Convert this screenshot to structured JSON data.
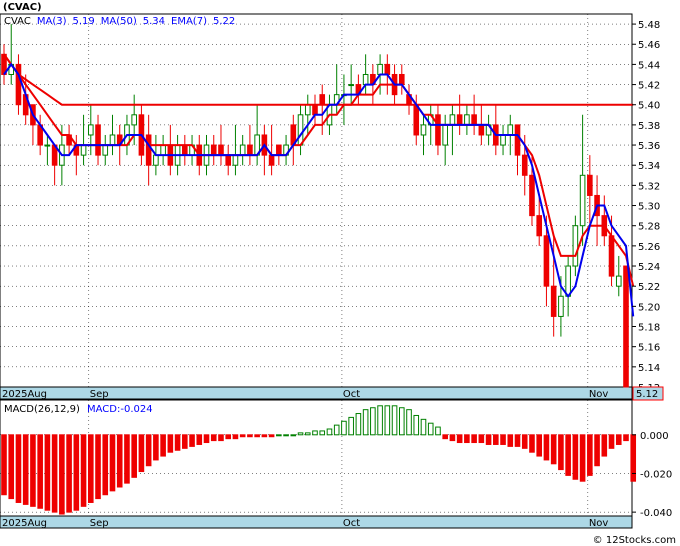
{
  "header": {
    "ticker": "(CVAC)",
    "legend": [
      {
        "label": "CVAC",
        "color": "#000000"
      },
      {
        "label": "MA(3)",
        "color": "#0000ff"
      },
      {
        "label": "5.19",
        "color": "#0000ff"
      },
      {
        "label": "MA(50)",
        "color": "#0000ff"
      },
      {
        "label": "5.34",
        "color": "#0000ff"
      },
      {
        "label": "EMA(7)",
        "color": "#0000ff"
      },
      {
        "label": "5.22",
        "color": "#0000ff"
      }
    ]
  },
  "macd_header": {
    "name": "MACD(26,12,9)",
    "value_label": "MACD:-0.024"
  },
  "footer": {
    "watermark": "© 12Stocks.com"
  },
  "colors": {
    "up": "#008000",
    "down": "#ee0000",
    "ma3": "#0000ee",
    "ema": "#ee0000",
    "axis_bg": "#add8e6",
    "last_price_bg": "#add8e6",
    "grid": "#000000"
  },
  "chart_data": [
    {
      "type": "candlestick",
      "title": "(CVAC)",
      "ylim": [
        5.12,
        5.49
      ],
      "yticks": [
        5.12,
        5.14,
        5.16,
        5.18,
        5.2,
        5.22,
        5.24,
        5.26,
        5.28,
        5.3,
        5.32,
        5.34,
        5.36,
        5.38,
        5.4,
        5.42,
        5.44,
        5.46,
        5.48
      ],
      "last_price": "5.12",
      "x_labels": [
        "2025Aug",
        "Sep",
        "Oct",
        "Nov"
      ],
      "x_label_index": [
        0,
        12,
        47,
        81
      ],
      "grid": true,
      "ohlc": [
        [
          5.45,
          5.46,
          5.42,
          5.43
        ],
        [
          5.43,
          5.48,
          5.42,
          5.44
        ],
        [
          5.44,
          5.45,
          5.39,
          5.4
        ],
        [
          5.41,
          5.43,
          5.38,
          5.39
        ],
        [
          5.4,
          5.4,
          5.36,
          5.38
        ],
        [
          5.38,
          5.39,
          5.35,
          5.36
        ],
        [
          5.36,
          5.37,
          5.34,
          5.36
        ],
        [
          5.36,
          5.36,
          5.32,
          5.34
        ],
        [
          5.34,
          5.38,
          5.32,
          5.36
        ],
        [
          5.37,
          5.38,
          5.35,
          5.36
        ],
        [
          5.36,
          5.37,
          5.33,
          5.35
        ],
        [
          5.35,
          5.39,
          5.34,
          5.36
        ],
        [
          5.37,
          5.4,
          5.35,
          5.38
        ],
        [
          5.38,
          5.39,
          5.34,
          5.35
        ],
        [
          5.35,
          5.37,
          5.34,
          5.36
        ],
        [
          5.36,
          5.39,
          5.35,
          5.37
        ],
        [
          5.37,
          5.38,
          5.34,
          5.36
        ],
        [
          5.36,
          5.39,
          5.35,
          5.38
        ],
        [
          5.38,
          5.41,
          5.36,
          5.39
        ],
        [
          5.39,
          5.4,
          5.34,
          5.35
        ],
        [
          5.37,
          5.39,
          5.32,
          5.34
        ],
        [
          5.34,
          5.37,
          5.33,
          5.35
        ],
        [
          5.35,
          5.37,
          5.34,
          5.36
        ],
        [
          5.36,
          5.38,
          5.33,
          5.34
        ],
        [
          5.34,
          5.37,
          5.33,
          5.36
        ],
        [
          5.36,
          5.37,
          5.34,
          5.35
        ],
        [
          5.35,
          5.37,
          5.34,
          5.36
        ],
        [
          5.36,
          5.37,
          5.33,
          5.34
        ],
        [
          5.34,
          5.37,
          5.33,
          5.36
        ],
        [
          5.36,
          5.37,
          5.34,
          5.35
        ],
        [
          5.36,
          5.38,
          5.34,
          5.35
        ],
        [
          5.35,
          5.36,
          5.33,
          5.34
        ],
        [
          5.34,
          5.38,
          5.33,
          5.35
        ],
        [
          5.35,
          5.37,
          5.34,
          5.36
        ],
        [
          5.36,
          5.38,
          5.34,
          5.35
        ],
        [
          5.35,
          5.4,
          5.34,
          5.37
        ],
        [
          5.37,
          5.38,
          5.33,
          5.35
        ],
        [
          5.35,
          5.38,
          5.33,
          5.34
        ],
        [
          5.36,
          5.36,
          5.34,
          5.35
        ],
        [
          5.35,
          5.37,
          5.34,
          5.36
        ],
        [
          5.38,
          5.39,
          5.34,
          5.36
        ],
        [
          5.36,
          5.4,
          5.35,
          5.39
        ],
        [
          5.39,
          5.41,
          5.37,
          5.4
        ],
        [
          5.4,
          5.41,
          5.38,
          5.39
        ],
        [
          5.41,
          5.42,
          5.37,
          5.4
        ],
        [
          5.38,
          5.41,
          5.37,
          5.4
        ],
        [
          5.4,
          5.44,
          5.39,
          5.41
        ],
        [
          5.41,
          5.43,
          5.38,
          5.41
        ],
        [
          5.42,
          5.44,
          5.4,
          5.42
        ],
        [
          5.42,
          5.43,
          5.4,
          5.41
        ],
        [
          5.42,
          5.45,
          5.41,
          5.43
        ],
        [
          5.43,
          5.44,
          5.4,
          5.42
        ],
        [
          5.43,
          5.45,
          5.41,
          5.44
        ],
        [
          5.44,
          5.45,
          5.41,
          5.43
        ],
        [
          5.43,
          5.44,
          5.4,
          5.41
        ],
        [
          5.43,
          5.44,
          5.41,
          5.42
        ],
        [
          5.41,
          5.42,
          5.39,
          5.4
        ],
        [
          5.4,
          5.41,
          5.36,
          5.37
        ],
        [
          5.37,
          5.39,
          5.35,
          5.38
        ],
        [
          5.38,
          5.4,
          5.36,
          5.39
        ],
        [
          5.39,
          5.4,
          5.35,
          5.36
        ],
        [
          5.36,
          5.39,
          5.34,
          5.38
        ],
        [
          5.38,
          5.4,
          5.35,
          5.39
        ],
        [
          5.39,
          5.41,
          5.37,
          5.38
        ],
        [
          5.38,
          5.4,
          5.37,
          5.39
        ],
        [
          5.39,
          5.41,
          5.37,
          5.38
        ],
        [
          5.38,
          5.4,
          5.36,
          5.37
        ],
        [
          5.37,
          5.39,
          5.36,
          5.38
        ],
        [
          5.38,
          5.4,
          5.35,
          5.36
        ],
        [
          5.36,
          5.38,
          5.35,
          5.37
        ],
        [
          5.37,
          5.39,
          5.35,
          5.38
        ],
        [
          5.38,
          5.38,
          5.33,
          5.35
        ],
        [
          5.35,
          5.37,
          5.31,
          5.33
        ],
        [
          5.33,
          5.35,
          5.28,
          5.29
        ],
        [
          5.29,
          5.31,
          5.26,
          5.27
        ],
        [
          5.27,
          5.29,
          5.2,
          5.22
        ],
        [
          5.22,
          5.27,
          5.17,
          5.19
        ],
        [
          5.19,
          5.23,
          5.17,
          5.21
        ],
        [
          5.21,
          5.25,
          5.19,
          5.24
        ],
        [
          5.24,
          5.29,
          5.23,
          5.28
        ],
        [
          5.28,
          5.39,
          5.26,
          5.33
        ],
        [
          5.33,
          5.35,
          5.28,
          5.31
        ],
        [
          5.31,
          5.33,
          5.26,
          5.29
        ],
        [
          5.29,
          5.31,
          5.26,
          5.27
        ],
        [
          5.27,
          5.29,
          5.22,
          5.23
        ],
        [
          5.22,
          5.25,
          5.21,
          5.23
        ],
        [
          5.24,
          5.24,
          5.12,
          5.12
        ]
      ],
      "ma3": [
        5.43,
        5.44,
        5.43,
        5.41,
        5.39,
        5.38,
        5.37,
        5.36,
        5.35,
        5.35,
        5.36,
        5.36,
        5.36,
        5.36,
        5.36,
        5.36,
        5.36,
        5.37,
        5.37,
        5.37,
        5.36,
        5.35,
        5.35,
        5.35,
        5.35,
        5.35,
        5.35,
        5.35,
        5.35,
        5.35,
        5.35,
        5.35,
        5.35,
        5.35,
        5.35,
        5.35,
        5.36,
        5.35,
        5.35,
        5.35,
        5.36,
        5.37,
        5.38,
        5.39,
        5.39,
        5.4,
        5.4,
        5.41,
        5.41,
        5.41,
        5.42,
        5.42,
        5.43,
        5.43,
        5.42,
        5.42,
        5.41,
        5.4,
        5.39,
        5.38,
        5.38,
        5.38,
        5.38,
        5.38,
        5.38,
        5.38,
        5.38,
        5.38,
        5.37,
        5.37,
        5.37,
        5.37,
        5.36,
        5.34,
        5.31,
        5.28,
        5.25,
        5.22,
        5.21,
        5.22,
        5.25,
        5.28,
        5.3,
        5.3,
        5.28,
        5.27,
        5.26,
        5.19
      ],
      "ema7": [
        5.45,
        5.44,
        5.43,
        5.42,
        5.41,
        5.4,
        5.39,
        5.38,
        5.37,
        5.37,
        5.36,
        5.36,
        5.36,
        5.36,
        5.36,
        5.36,
        5.36,
        5.36,
        5.37,
        5.37,
        5.36,
        5.36,
        5.36,
        5.36,
        5.36,
        5.36,
        5.36,
        5.35,
        5.35,
        5.35,
        5.35,
        5.35,
        5.35,
        5.35,
        5.35,
        5.35,
        5.36,
        5.35,
        5.35,
        5.35,
        5.36,
        5.36,
        5.37,
        5.38,
        5.38,
        5.39,
        5.39,
        5.4,
        5.4,
        5.41,
        5.41,
        5.41,
        5.42,
        5.42,
        5.42,
        5.42,
        5.41,
        5.4,
        5.39,
        5.39,
        5.38,
        5.38,
        5.38,
        5.38,
        5.38,
        5.38,
        5.38,
        5.38,
        5.37,
        5.37,
        5.37,
        5.37,
        5.36,
        5.35,
        5.33,
        5.3,
        5.27,
        5.25,
        5.25,
        5.25,
        5.27,
        5.28,
        5.28,
        5.28,
        5.27,
        5.26,
        5.25,
        5.22
      ],
      "ma50": [
        5.45,
        5.44,
        5.43,
        5.425,
        5.42,
        5.415,
        5.41,
        5.405,
        5.4,
        5.4,
        5.4,
        5.4,
        5.4,
        5.4,
        5.4,
        5.4,
        5.4,
        5.4,
        5.4,
        5.4,
        5.4,
        5.4,
        5.4,
        5.4,
        5.4,
        5.4,
        5.4,
        5.4,
        5.4,
        5.4,
        5.4,
        5.4,
        5.4,
        5.4,
        5.4,
        5.4,
        5.4,
        5.4,
        5.4,
        5.4,
        5.4,
        5.4,
        5.4,
        5.4,
        5.4,
        5.4,
        5.4,
        5.4,
        5.4,
        5.4,
        5.4,
        5.4,
        5.4,
        5.4,
        5.4,
        5.4,
        5.4,
        5.4,
        5.4,
        5.4,
        5.4,
        5.4,
        5.4,
        5.4,
        5.4,
        5.4,
        5.4,
        5.4,
        5.4,
        5.4,
        5.4,
        5.4,
        5.4,
        5.4,
        5.4,
        5.4,
        5.4,
        5.4,
        5.4,
        5.4,
        5.4,
        5.4,
        5.4,
        5.4,
        5.4,
        5.4,
        5.4,
        5.4
      ]
    },
    {
      "type": "bar",
      "title": "MACD(26,12,9)",
      "ylim": [
        -0.042,
        0.018
      ],
      "yticks": [
        0.0,
        -0.02,
        -0.04
      ],
      "ytick_labels": [
        "0.000",
        "-0.020",
        "-0.040"
      ],
      "x_labels": [
        "2025Aug",
        "Sep",
        "Oct",
        "Nov"
      ],
      "x_label_index": [
        0,
        12,
        47,
        81
      ],
      "values": [
        -0.031,
        -0.033,
        -0.035,
        -0.036,
        -0.037,
        -0.038,
        -0.039,
        -0.04,
        -0.041,
        -0.04,
        -0.039,
        -0.037,
        -0.035,
        -0.033,
        -0.031,
        -0.029,
        -0.027,
        -0.025,
        -0.022,
        -0.019,
        -0.016,
        -0.013,
        -0.011,
        -0.009,
        -0.008,
        -0.007,
        -0.006,
        -0.005,
        -0.004,
        -0.003,
        -0.003,
        -0.002,
        -0.002,
        -0.001,
        -0.001,
        -0.001,
        -0.001,
        -0.001,
        0.0,
        0.0,
        0.0,
        0.001,
        0.001,
        0.002,
        0.002,
        0.003,
        0.005,
        0.007,
        0.009,
        0.011,
        0.013,
        0.014,
        0.015,
        0.015,
        0.015,
        0.014,
        0.013,
        0.01,
        0.008,
        0.006,
        0.004,
        -0.002,
        -0.003,
        -0.004,
        -0.004,
        -0.004,
        -0.004,
        -0.005,
        -0.005,
        -0.005,
        -0.006,
        -0.006,
        -0.007,
        -0.009,
        -0.011,
        -0.013,
        -0.015,
        -0.018,
        -0.021,
        -0.023,
        -0.024,
        -0.021,
        -0.016,
        -0.011,
        -0.007,
        -0.005,
        -0.003,
        -0.024
      ]
    }
  ]
}
